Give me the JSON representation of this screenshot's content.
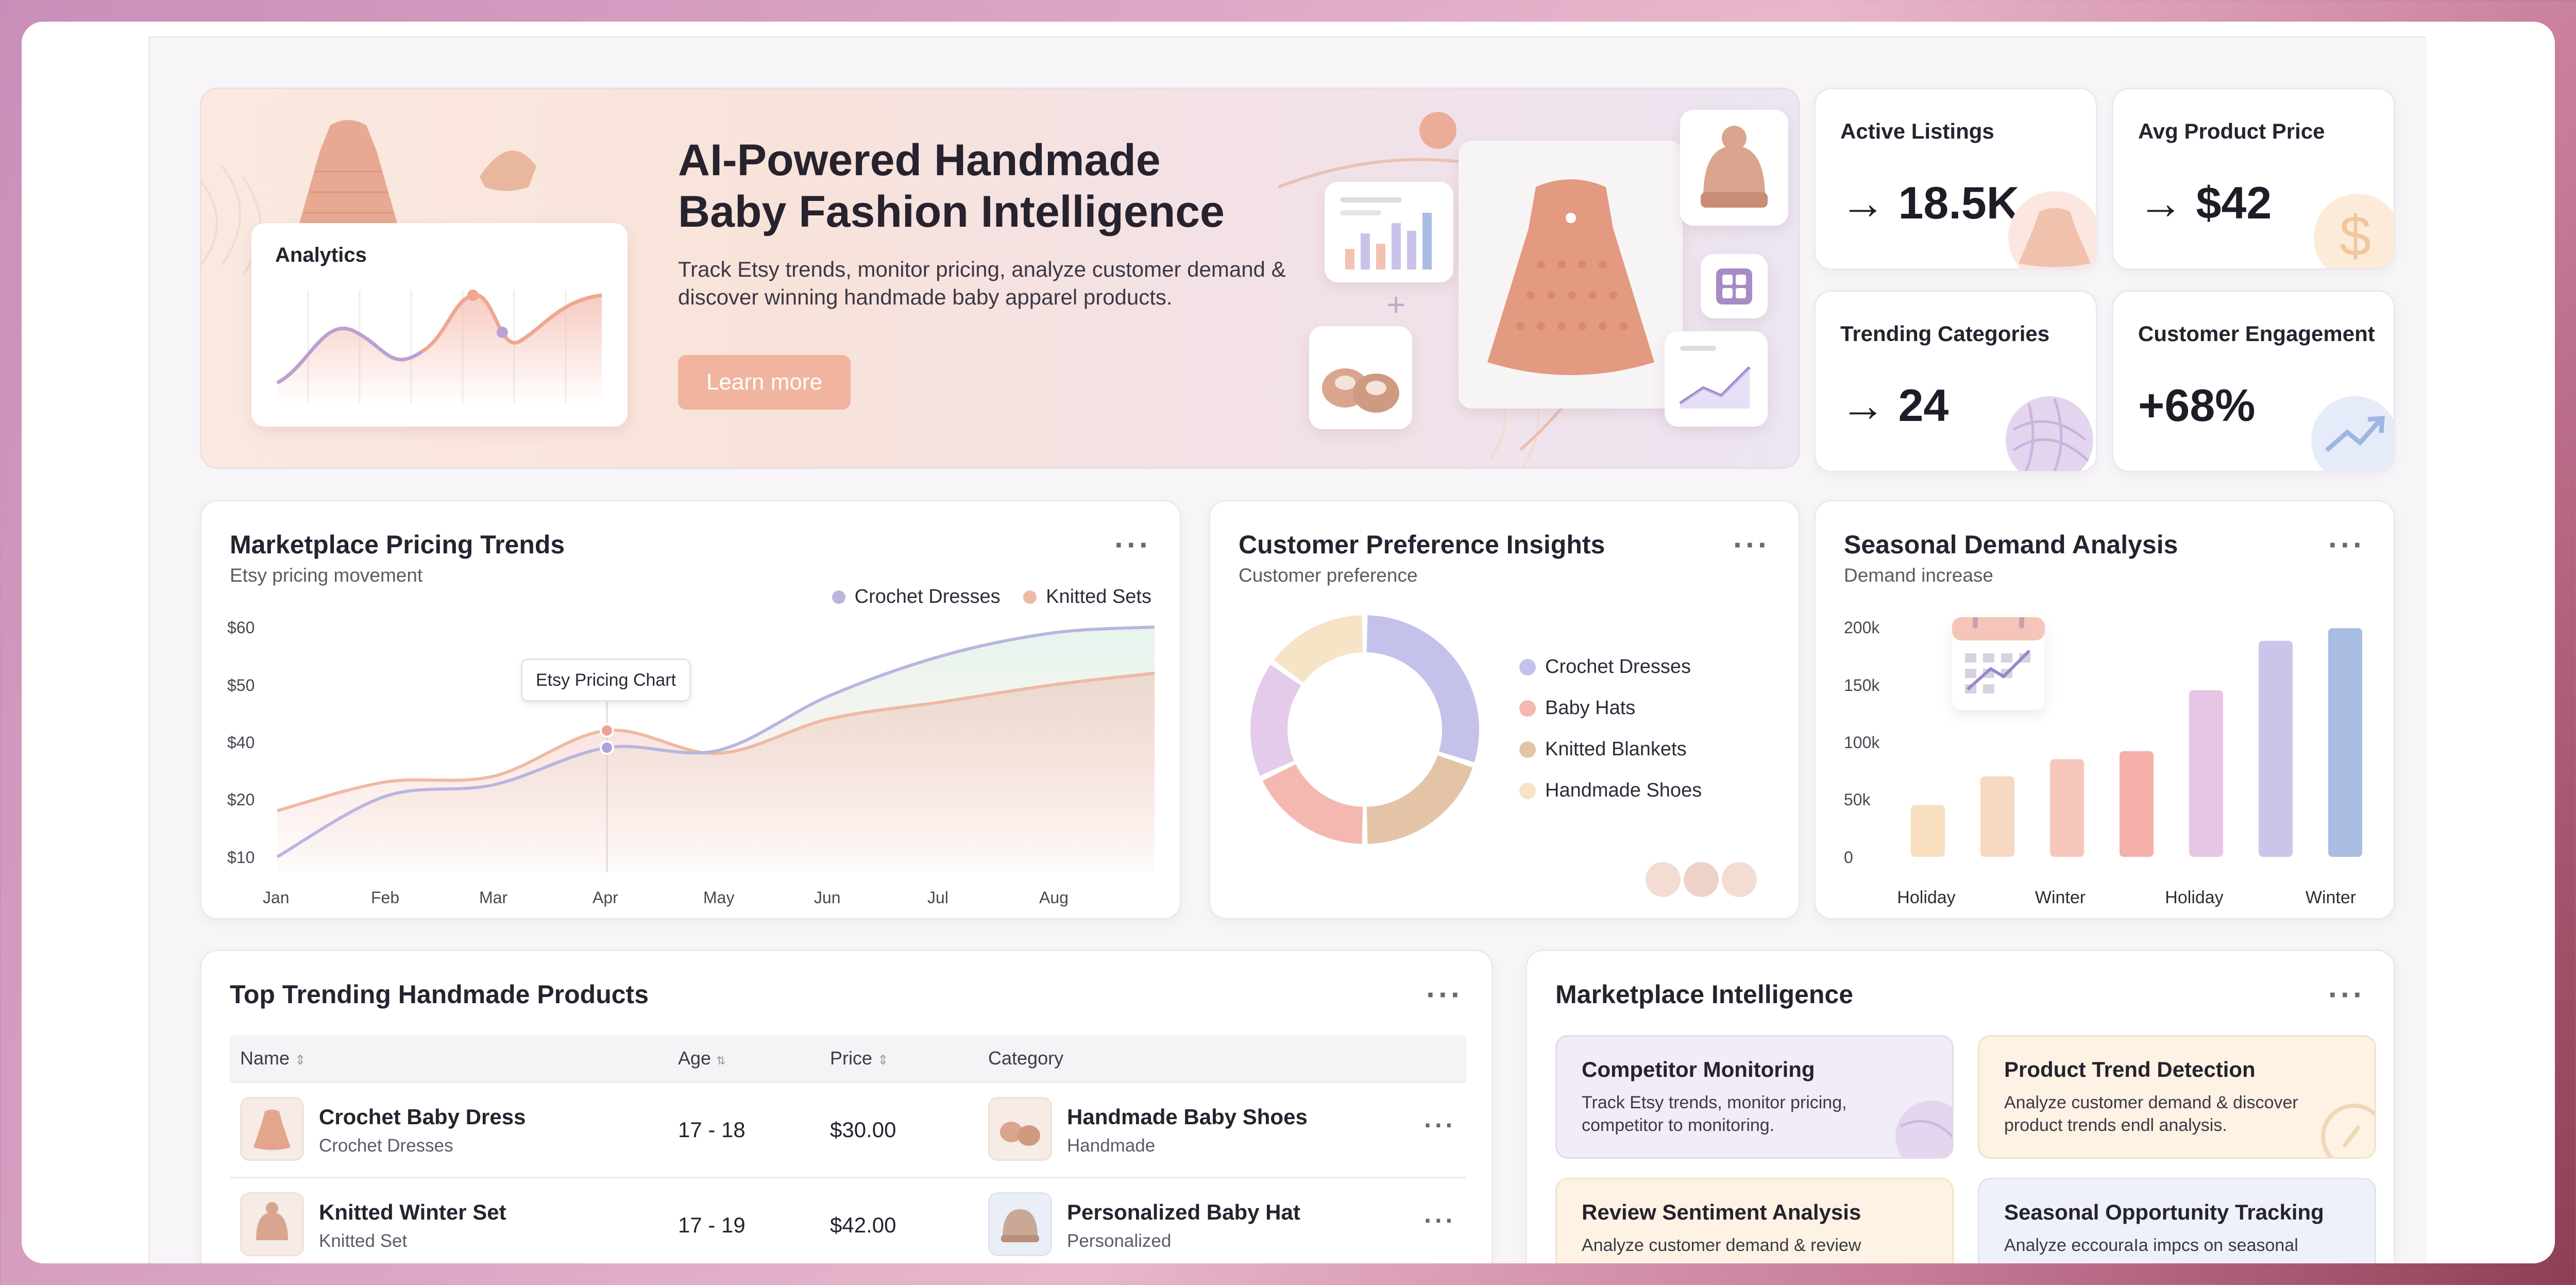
{
  "hero": {
    "title_line1": "AI-Powered Handmade",
    "title_line2": "Baby Fashion Intelligence",
    "description": "Track Etsy trends, monitor pricing, analyze customer demand & discover winning handmade baby apparel products.",
    "button": "Learn more",
    "analytics_label": "Analytics"
  },
  "stats": [
    {
      "label": "Active Listings",
      "value": "18.5K",
      "arrow": "→"
    },
    {
      "label": "Avg Product Price",
      "value": "$42",
      "arrow": "→"
    },
    {
      "label": "Trending Categories",
      "value": "24",
      "arrow": "→"
    },
    {
      "label": "Customer Engagement",
      "value": "+68%",
      "arrow": ""
    }
  ],
  "pricing": {
    "title": "Marketplace Pricing Trends",
    "subtitle": "Etsy pricing movement",
    "tooltip": "Etsy Pricing Chart",
    "menu": "···"
  },
  "preference": {
    "title": "Customer Preference Insights",
    "subtitle": "Customer preference",
    "menu": "···"
  },
  "seasonal": {
    "title": "Seasonal Demand Analysis",
    "subtitle": "Demand increase",
    "menu": "···"
  },
  "chart_data": [
    {
      "type": "line",
      "title": "Marketplace Pricing Trends",
      "subtitle": "Etsy pricing movement",
      "x": [
        "Jan",
        "Feb",
        "Mar",
        "Apr",
        "May",
        "Jun",
        "Jul",
        "Aug"
      ],
      "yticks": [
        "$60",
        "$50",
        "$40",
        "$20",
        "$10"
      ],
      "series": [
        {
          "name": "Crochet Dresses",
          "color": "#b8b6df",
          "values": [
            10,
            21,
            25,
            38,
            37,
            48,
            55,
            59
          ]
        },
        {
          "name": "Knitted Sets",
          "color": "#eeb9a4",
          "values": [
            18,
            26,
            28,
            42,
            36,
            44,
            47,
            50
          ]
        }
      ],
      "legend": "top-right",
      "grid": false
    },
    {
      "type": "pie",
      "title": "Customer Preference Insights",
      "subtitle": "Customer preference",
      "labels": [
        "Crochet Dresses",
        "Baby Hats",
        "Knitted Blankets",
        "Handmade Shoes"
      ],
      "values": [
        30,
        20,
        20,
        30
      ],
      "colors": [
        "#c4c1ea",
        "#f4b8b1",
        "#e3c4a6",
        "#f7e3c6"
      ],
      "extra_colors": [
        "#e4cbe9",
        "#f7e3c6"
      ]
    },
    {
      "type": "bar",
      "title": "Seasonal Demand Analysis",
      "subtitle": "Demand increase",
      "xticks": [
        "Holiday",
        "Winter",
        "Holiday",
        "Winter"
      ],
      "yticks": [
        "200k",
        "150k",
        "100k",
        "50k",
        "0"
      ],
      "values": [
        45,
        70,
        85,
        92,
        145,
        188,
        199
      ],
      "colors": [
        "#f8dfbf",
        "#f7d8c2",
        "#f6c8bb",
        "#f4b0a9",
        "#e7c5e4",
        "#ccc5ea",
        "#a9bde3"
      ],
      "ylim": [
        0,
        200
      ]
    }
  ],
  "products": {
    "title": "Top Trending Handmade Products",
    "menu": "···",
    "headers": {
      "name": "Name",
      "age": "Age",
      "price": "Price",
      "category": "Category"
    },
    "rows": [
      {
        "name": "Crochet Baby Dress",
        "sub": "Crochet Dresses",
        "age": "17 - 18",
        "price": "$30.00",
        "cat": "Handmade Baby Shoes",
        "cat_sub": "Handmade"
      },
      {
        "name": "Knitted Winter Set",
        "sub": "Knitted Set",
        "age": "17 - 19",
        "price": "$42.00",
        "cat": "Personalized Baby Hat",
        "cat_sub": "Personalized"
      }
    ]
  },
  "intel": {
    "title": "Marketplace Intelligence",
    "menu": "···",
    "tiles": [
      {
        "title": "Competitor Monitoring",
        "desc": "Track  Etsy trends, monitor pricing, competitor to monitoring."
      },
      {
        "title": "Product Trend Detection",
        "desc": "Analyze customer demand & discover product trends endl analysis."
      },
      {
        "title": "Review Sentiment Analysis",
        "desc": "Analyze customer demand & review"
      },
      {
        "title": "Seasonal Opportunity Tracking",
        "desc": "Analyze eccouraIa impcs on seasonal"
      }
    ]
  }
}
